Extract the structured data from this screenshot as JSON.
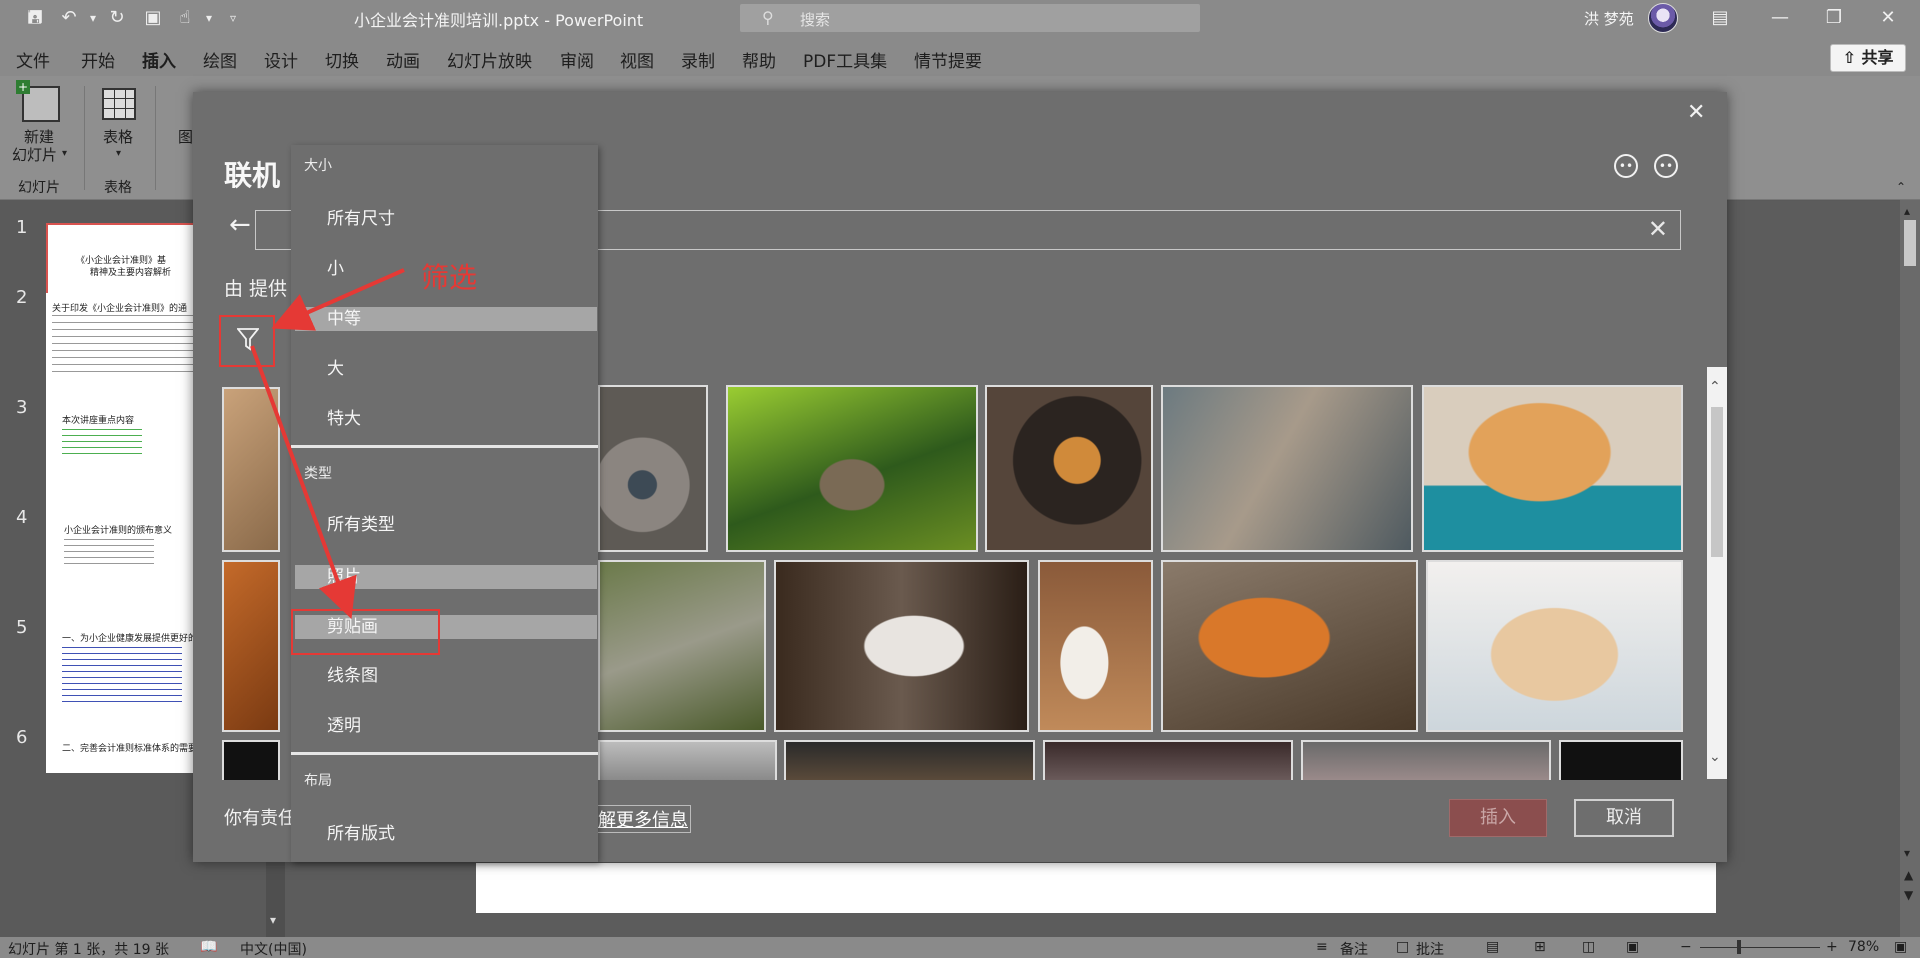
{
  "titlebar": {
    "doc_title": "小企业会计准则培训.pptx  -  PowerPoint",
    "search_placeholder": "搜索",
    "user_name": "洪 梦苑"
  },
  "menu": {
    "tabs": [
      "文件",
      "开始",
      "插入",
      "绘图",
      "设计",
      "切换",
      "动画",
      "幻灯片放映",
      "审阅",
      "视图",
      "录制",
      "帮助",
      "PDF工具集",
      "情节提要"
    ],
    "share": "共享"
  },
  "ribbon": {
    "new_slide_line1": "新建",
    "new_slide_line2": "幻灯片",
    "table": "表格",
    "picture_partial": "图",
    "group_slides": "幻灯片",
    "group_tables": "表格"
  },
  "thumbnails": {
    "nums": [
      "1",
      "2",
      "3",
      "4",
      "5",
      "6"
    ],
    "s1_title1": "《小企业会计准则》基",
    "s1_title2": "精神及主要内容解析",
    "s2_title": "关于印发《小企业会计准则》的通",
    "s3_title": "本次讲座重点内容",
    "s4_title": "小企业会计准则的颁布意义",
    "s5_title": "一、为小企业健康发展提供更好的",
    "s6_title": "二、完善会计准则标准体系的需要"
  },
  "dialog": {
    "title": "联机",
    "provided_by": "由 提供",
    "footer_text": "你有责任",
    "learn_more": "解更多信息",
    "insert": "插入",
    "cancel": "取消"
  },
  "filter_menu": {
    "size_header": "大小",
    "size_items": [
      "所有尺寸",
      "小",
      "中等",
      "大",
      "特大"
    ],
    "type_header": "类型",
    "type_items": [
      "所有类型",
      "照片",
      "剪贴画",
      "线条图",
      "透明"
    ],
    "layout_header": "布局",
    "layout_items": [
      "所有版式"
    ]
  },
  "annotation": {
    "label": "筛选"
  },
  "statusbar": {
    "slide_info": "幻灯片 第 1 张，共 19 张",
    "language": "中文(中国)",
    "notes": "备注",
    "comments": "批注",
    "zoom": "78%"
  },
  "colors": {
    "annotation_red": "#e53935",
    "dialog_bg": "#6e6e6e",
    "insert_button": "#8b4e4e"
  }
}
